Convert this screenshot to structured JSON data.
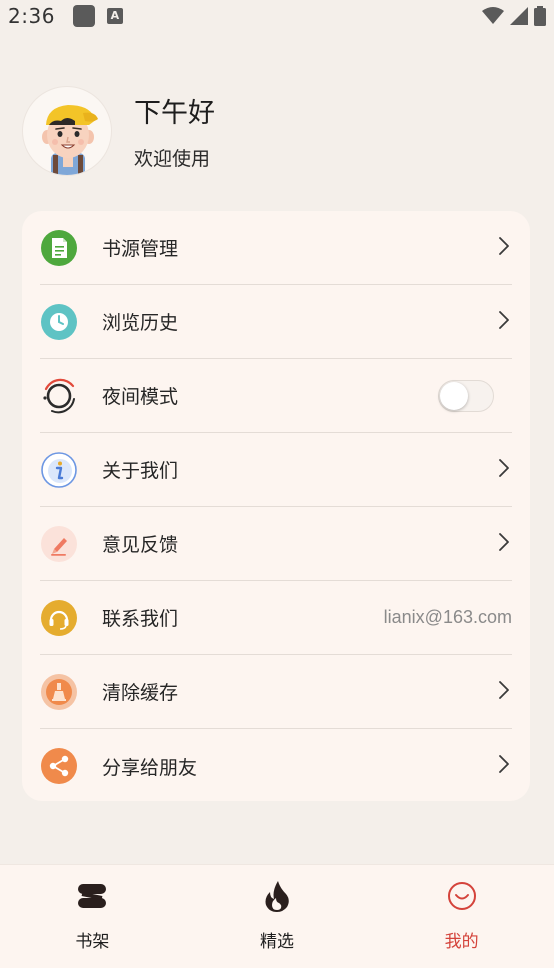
{
  "status_bar": {
    "time": "2:36",
    "icons": [
      "notification-square-icon",
      "text-a-icon",
      "wifi-icon",
      "signal-icon",
      "battery-icon"
    ]
  },
  "profile": {
    "greeting": "下午好",
    "subtitle": "欢迎使用",
    "avatar": "cartoon-boy-avatar"
  },
  "menu": {
    "items": [
      {
        "label": "书源管理",
        "icon": "document-icon",
        "trailing": "chevron"
      },
      {
        "label": "浏览历史",
        "icon": "clock-icon",
        "trailing": "chevron"
      },
      {
        "label": "夜间模式",
        "icon": "night-mode-icon",
        "trailing": "toggle",
        "toggle_on": false
      },
      {
        "label": "关于我们",
        "icon": "info-icon",
        "trailing": "chevron"
      },
      {
        "label": "意见反馈",
        "icon": "feedback-pen-icon",
        "trailing": "chevron"
      },
      {
        "label": "联系我们",
        "icon": "headset-icon",
        "trailing": "text",
        "trailing_text": "lianix@163.com"
      },
      {
        "label": "清除缓存",
        "icon": "broom-icon",
        "trailing": "chevron"
      },
      {
        "label": "分享给朋友",
        "icon": "share-icon",
        "trailing": "chevron"
      }
    ]
  },
  "bottom_nav": {
    "items": [
      {
        "label": "书架",
        "icon": "bookshelf-icon",
        "active": false
      },
      {
        "label": "精选",
        "icon": "flame-icon",
        "active": false
      },
      {
        "label": "我的",
        "icon": "smiley-icon",
        "active": true
      }
    ]
  },
  "colors": {
    "background": "#f4efea",
    "card": "#fdf5f0",
    "active": "#d4433b",
    "divider": "#e4dcd6"
  }
}
